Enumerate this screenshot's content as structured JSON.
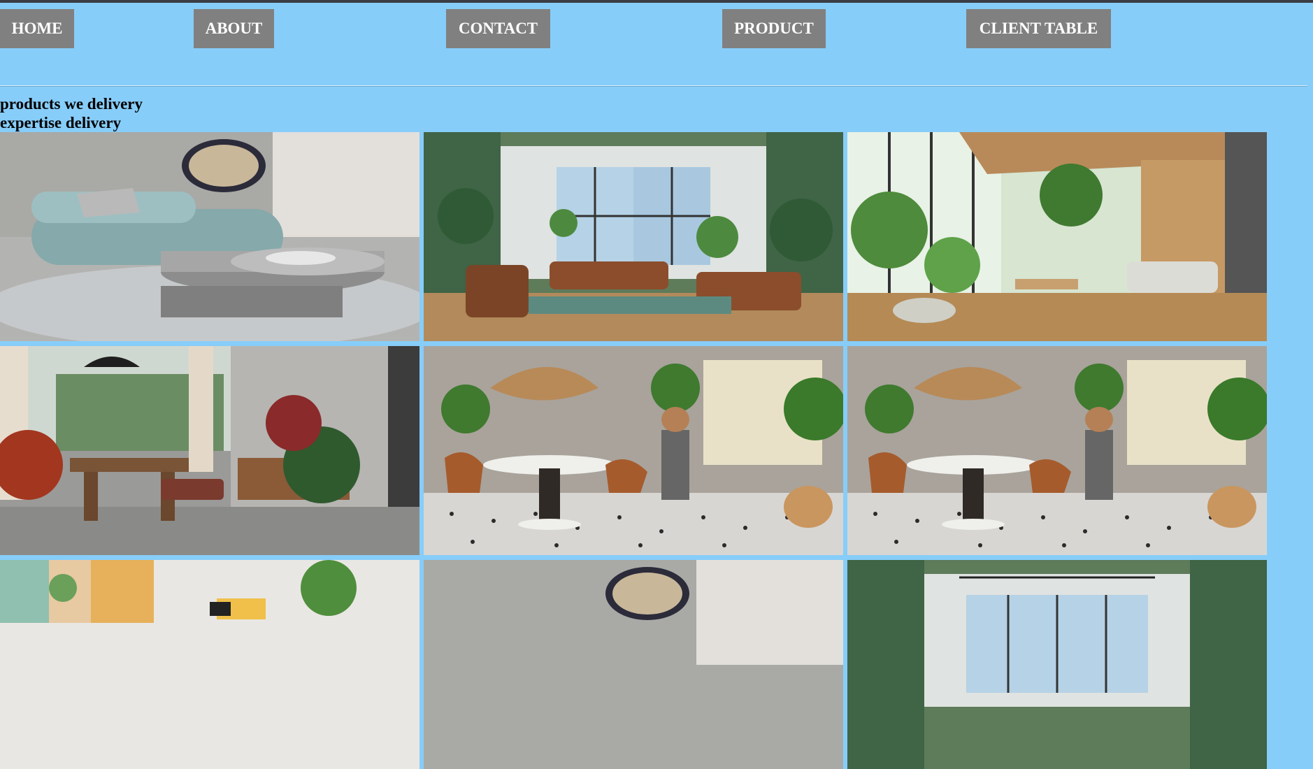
{
  "nav": {
    "items": [
      {
        "label": "HOME"
      },
      {
        "label": "ABOUT"
      },
      {
        "label": "CONTACT"
      },
      {
        "label": "PRODUCT"
      },
      {
        "label": "CLIENT TABLE"
      }
    ]
  },
  "content": {
    "heading_1": "products we delivery",
    "heading_2": "expertise delivery"
  },
  "gallery": {
    "images": [
      {
        "name": "sofa-living-room-image"
      },
      {
        "name": "green-wall-lounge-image"
      },
      {
        "name": "sunroom-plants-image"
      },
      {
        "name": "brick-dining-room-image"
      },
      {
        "name": "cafe-table-image"
      },
      {
        "name": "cafe-table-image"
      },
      {
        "name": "colorful-art-room-image"
      },
      {
        "name": "sofa-living-room-image"
      },
      {
        "name": "green-wall-lounge-image"
      }
    ]
  },
  "colors": {
    "background": "#87cdf9",
    "nav_button": "#808080",
    "nav_text": "#ffffff",
    "top_strip": "#3a3d44"
  }
}
